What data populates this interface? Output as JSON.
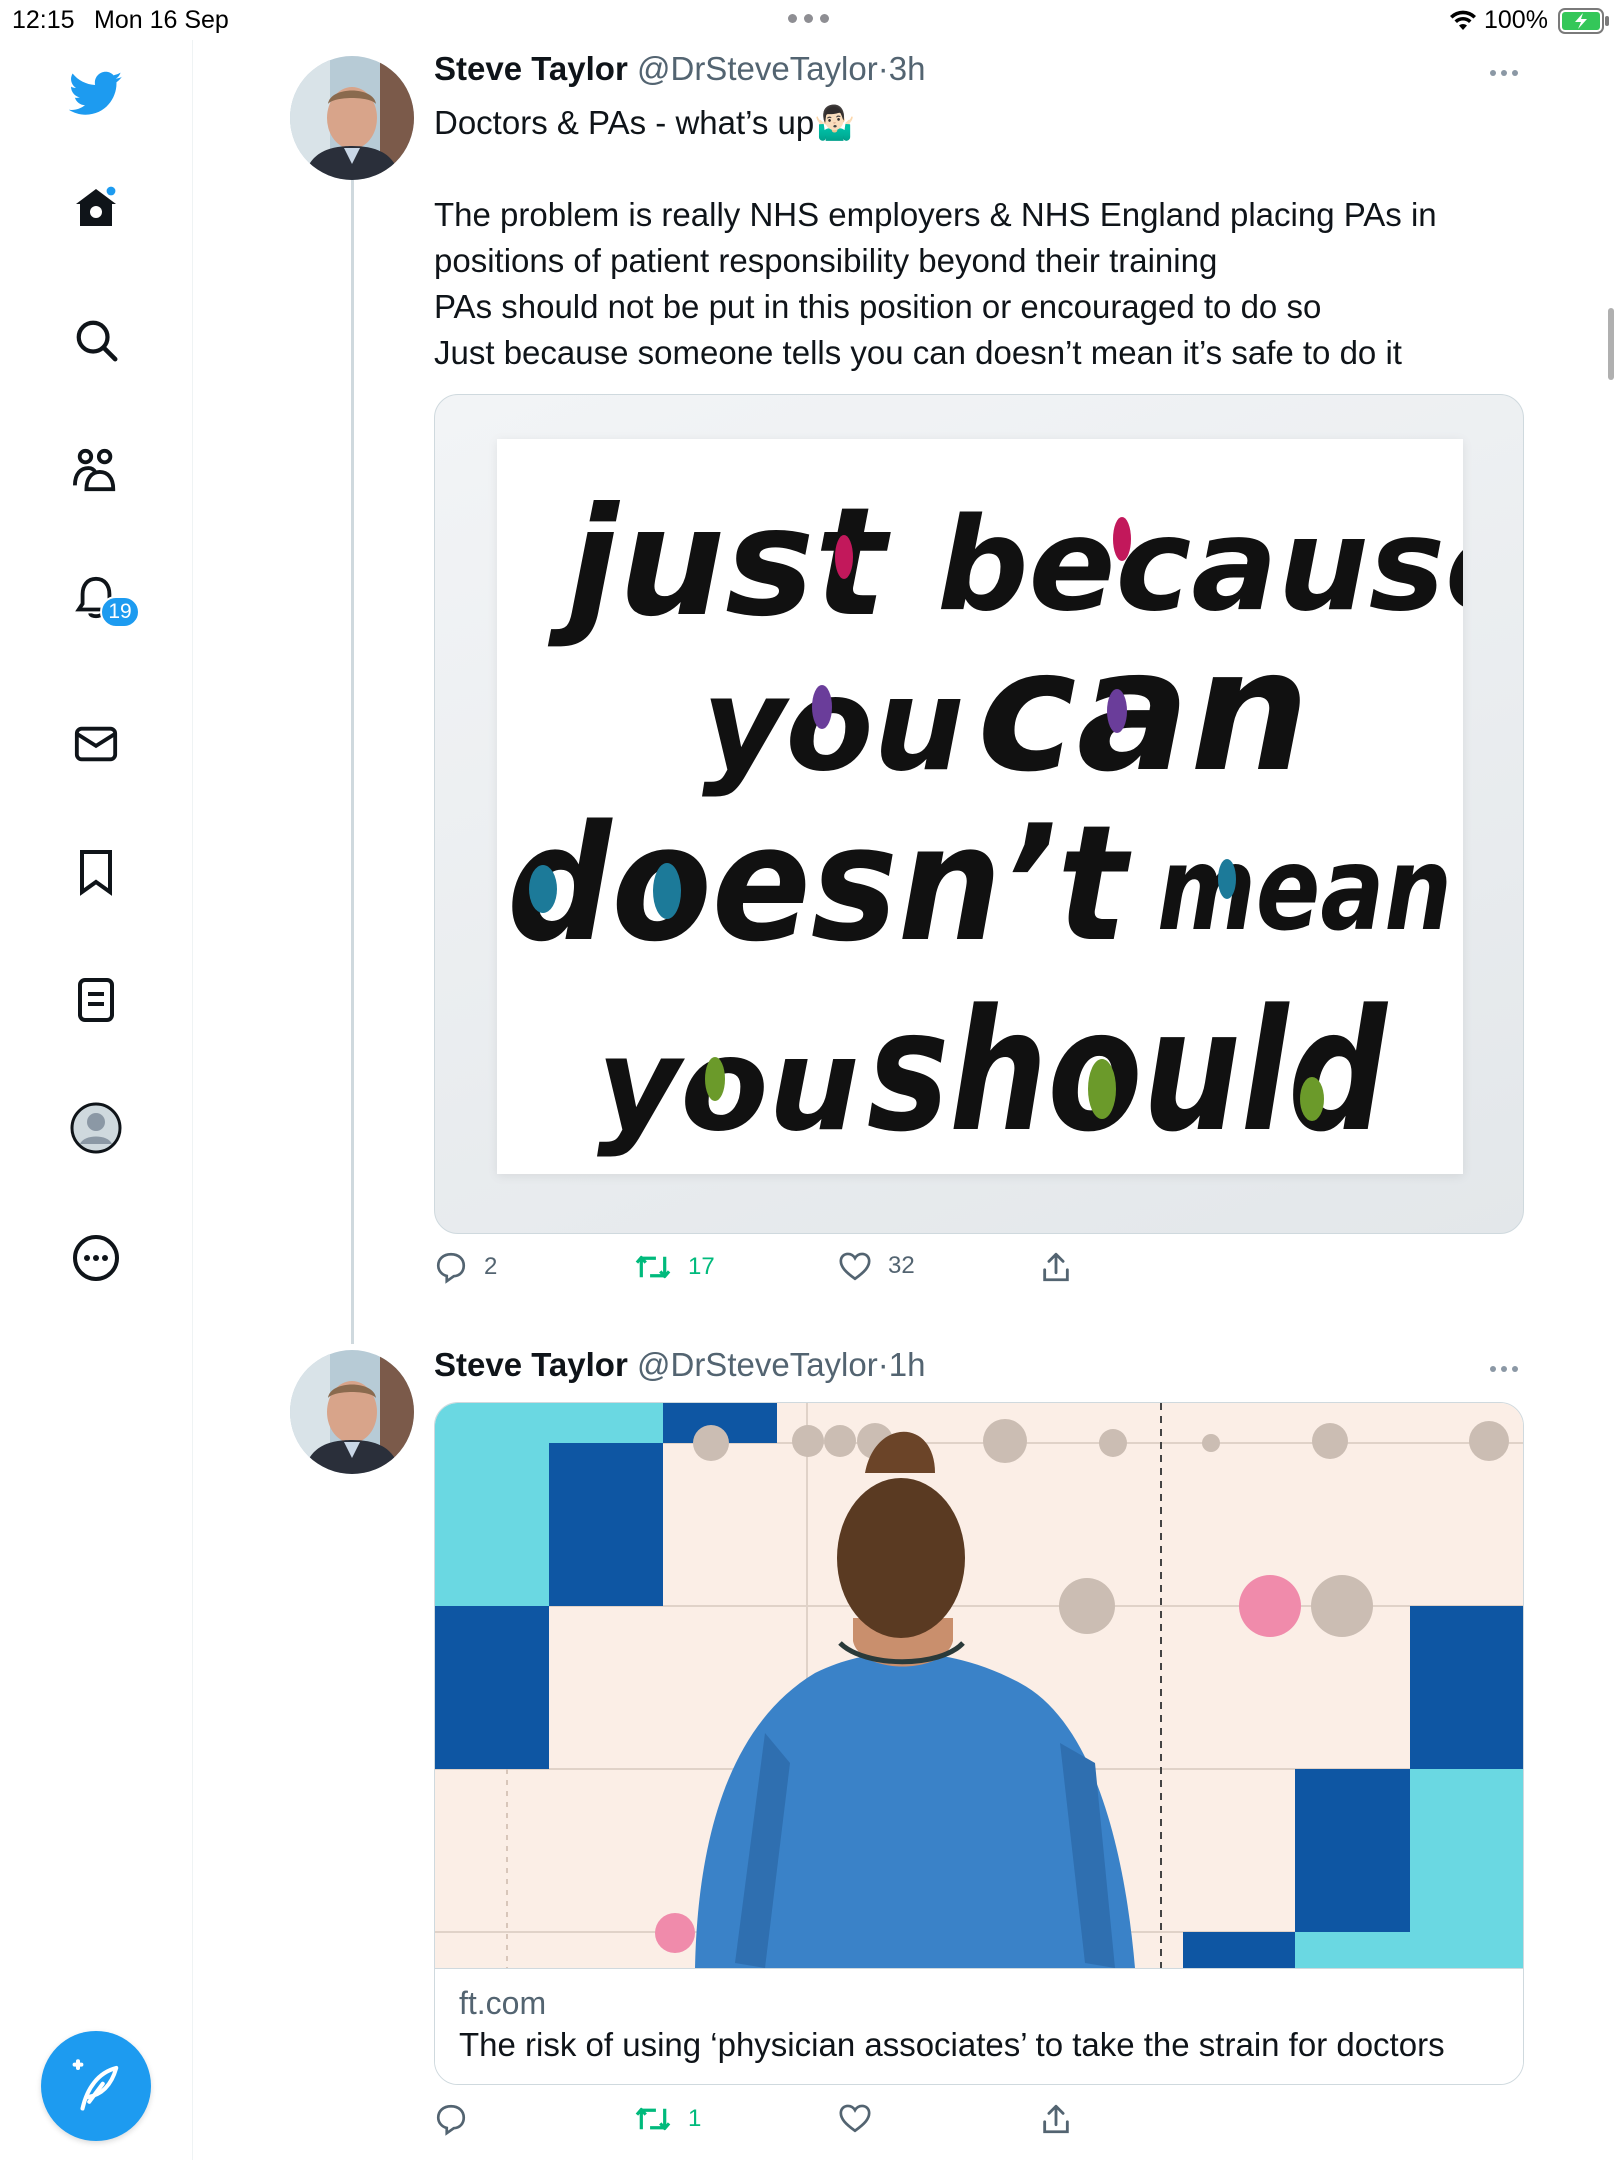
{
  "status_bar": {
    "time": "12:15",
    "date": "Mon 16 Sep",
    "battery": "100%"
  },
  "sidebar": {
    "items": [
      {
        "icon": "twitter-logo-icon"
      },
      {
        "icon": "home-icon"
      },
      {
        "icon": "search-icon"
      },
      {
        "icon": "communities-icon"
      },
      {
        "icon": "notifications-icon",
        "badge": "19"
      },
      {
        "icon": "messages-icon"
      },
      {
        "icon": "bookmarks-icon"
      },
      {
        "icon": "lists-icon"
      },
      {
        "icon": "profile-icon"
      },
      {
        "icon": "more-icon"
      }
    ],
    "compose_icon": "compose-tweet-icon",
    "accent": "#1d9bf0"
  },
  "tweets": [
    {
      "name": "Steve Taylor",
      "handle": "@DrSteveTaylor",
      "sep": "·",
      "age": "3h",
      "lines": [
        "Doctors & PAs - what’s up🤷🏻‍♂️",
        "",
        "The problem is really NHS employers & NHS England placing PAs in",
        "positions of patient responsibility beyond their training",
        "PAs should not be put in this position or encouraged to do so",
        "Just because someone tells you can doesn’t mean it’s safe to do it"
      ],
      "image_text": {
        "line1a": "just",
        "line1b": "because",
        "line2a": "you",
        "line2b": "can",
        "line3a": "doesn’t",
        "line3b": "mean",
        "line4a": "you",
        "line4b": "should"
      },
      "actions": {
        "replies": "2",
        "retweets": "17",
        "likes": "32"
      }
    },
    {
      "name": "Steve Taylor",
      "handle": "@DrSteveTaylor",
      "sep": "·",
      "age": "1h",
      "card": {
        "domain": "ft.com",
        "title": "The risk of using ‘physician associates’ to take the strain for doctors"
      },
      "actions": {
        "replies": "",
        "retweets": "1",
        "likes": ""
      }
    }
  ],
  "colors": {
    "retweet_green": "#00ba7c",
    "text_secondary": "#536471"
  }
}
